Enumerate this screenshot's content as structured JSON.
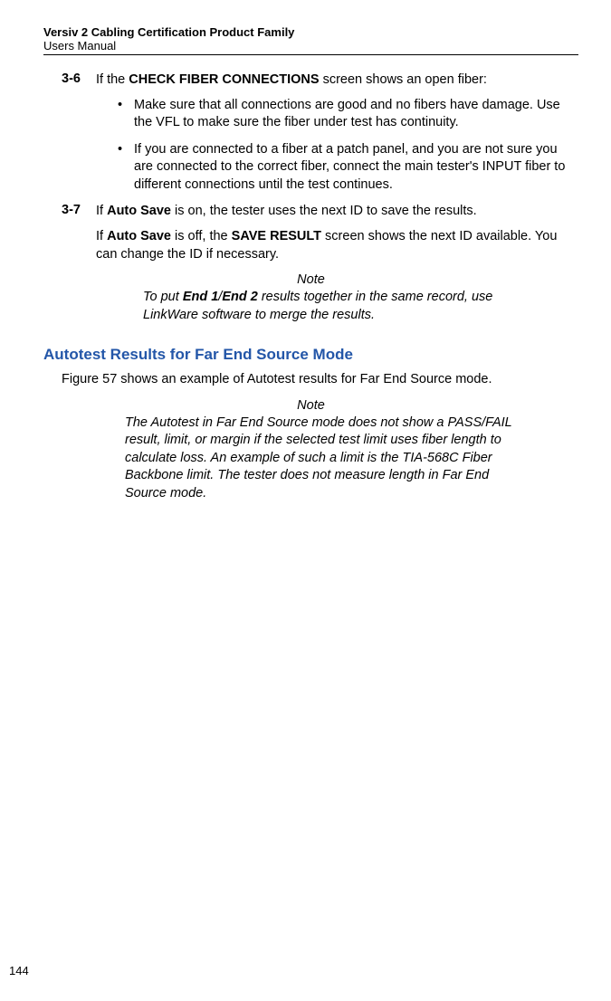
{
  "header": {
    "line1": "Versiv 2 Cabling Certification Product Family",
    "line2": "Users Manual"
  },
  "step36": {
    "num": "3-6",
    "prefix": "If the ",
    "bold1": "CHECK FIBER CONNECTIONS",
    "suffix": " screen shows an open fiber:"
  },
  "bullets": {
    "dot": "•",
    "b1": "Make sure that all connections are good and no fibers have damage. Use the VFL to make sure the fiber under test has continuity.",
    "b2": "If you are connected to a fiber at a patch panel, and you are not sure you are connected to the correct fiber, connect the main tester's INPUT fiber to different connections until the test continues."
  },
  "step37": {
    "num": "3-7",
    "t1": "If ",
    "b1": "Auto Save",
    "t2": " is on, the tester uses the next ID to save the results.",
    "p2a": "If ",
    "p2b": "Auto Save",
    "p2c": " is off, the ",
    "p2d": "SAVE RESULT",
    "p2e": " screen shows the next ID available. You can change the ID if necessary."
  },
  "note1": {
    "label": "Note",
    "t1": "To put ",
    "b1": "End 1",
    "t2": "/",
    "b2": "End 2",
    "t3": " results together in the same record, use LinkWare software to merge the results."
  },
  "section": {
    "heading": "Autotest Results for Far End Source Mode",
    "para": "Figure 57 shows an example of Autotest results for Far End Source mode."
  },
  "note2": {
    "label": "Note",
    "body": "The Autotest in Far End Source mode does not show a PASS/FAIL result, limit, or margin if the selected test limit uses fiber length to calculate loss. An example of such a limit is the TIA-568C Fiber Backbone limit. The tester does not measure length in Far End Source mode."
  },
  "pageNumber": "144"
}
